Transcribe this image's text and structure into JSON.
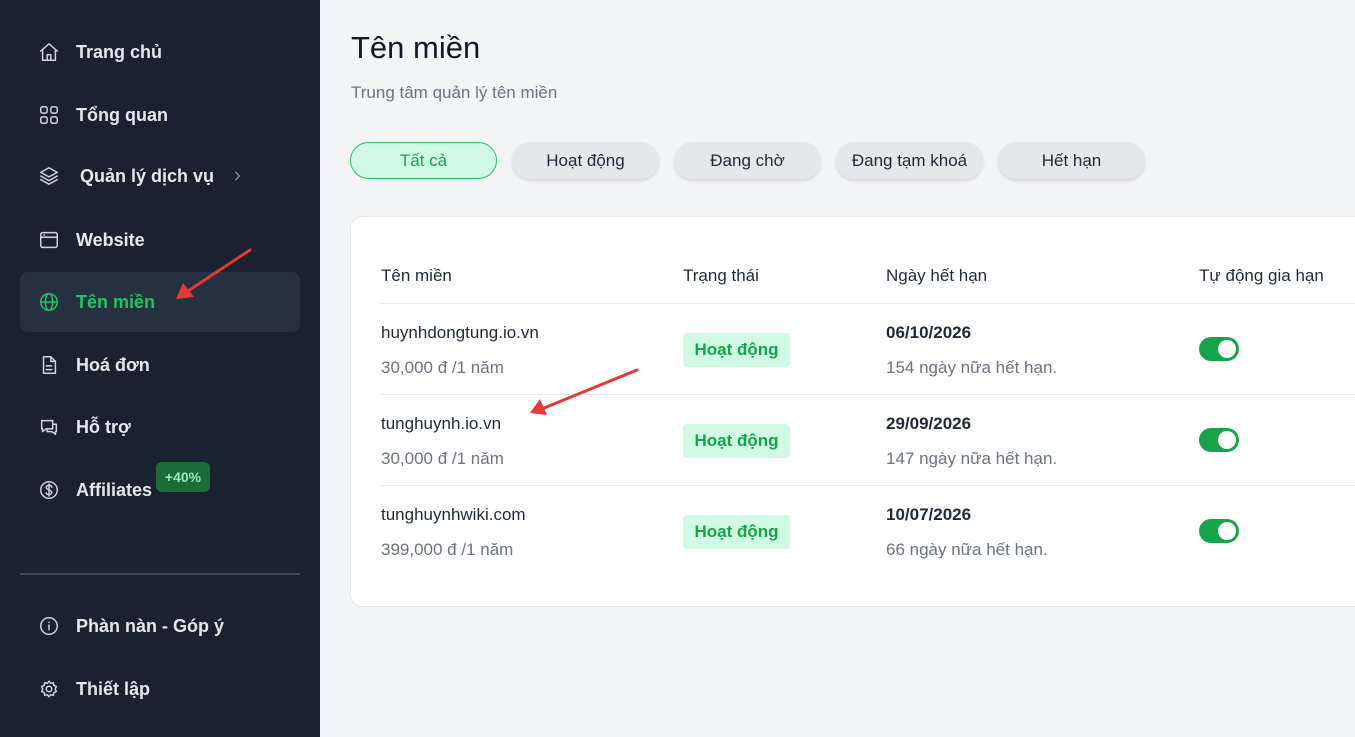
{
  "sidebar": {
    "items": [
      {
        "label": "Trang chủ",
        "icon": "home-icon"
      },
      {
        "label": "Tổng quan",
        "icon": "grid-icon"
      },
      {
        "label": "Quản lý dịch vụ",
        "icon": "layers-icon"
      },
      {
        "label": "Website",
        "icon": "browser-icon"
      },
      {
        "label": "Tên miền",
        "icon": "globe-icon",
        "active": true
      },
      {
        "label": "Hoá đơn",
        "icon": "invoice-icon"
      },
      {
        "label": "Hỗ trợ",
        "icon": "chat-icon"
      },
      {
        "label": "Affiliates",
        "icon": "dollar-icon",
        "badge": "+40%"
      }
    ],
    "bottom_items": [
      {
        "label": "Phàn nàn - Góp ý",
        "icon": "info-icon"
      },
      {
        "label": "Thiết lập",
        "icon": "gear-icon"
      }
    ]
  },
  "header": {
    "title": "Tên miền",
    "subtitle": "Trung tâm quản lý tên miền"
  },
  "filters": [
    "Tất cả",
    "Hoạt động",
    "Đang chờ",
    "Đang tạm khoá",
    "Hết hạn"
  ],
  "table": {
    "columns": [
      "Tên miền",
      "Trạng thái",
      "Ngày hết hạn",
      "Tự động gia hạn"
    ],
    "rows": [
      {
        "domain": "huynhdongtung.io.vn",
        "price": "30,000 đ /1 năm",
        "status": "Hoạt động",
        "expiry": "06/10/2026",
        "remaining": "154 ngày nữa hết hạn.",
        "auto_renew": true
      },
      {
        "domain": "tunghuynh.io.vn",
        "price": "30,000 đ /1 năm",
        "status": "Hoạt động",
        "expiry": "29/09/2026",
        "remaining": "147 ngày nữa hết hạn.",
        "auto_renew": true
      },
      {
        "domain": "tunghuynhwiki.com",
        "price": "399,000 đ /1 năm",
        "status": "Hoạt động",
        "expiry": "10/07/2026",
        "remaining": "66 ngày nữa hết hạn.",
        "auto_renew": true
      }
    ]
  },
  "colors": {
    "sidebar_bg": "#1a2232",
    "accent": "#22c55e",
    "annotation": "#e53935"
  }
}
